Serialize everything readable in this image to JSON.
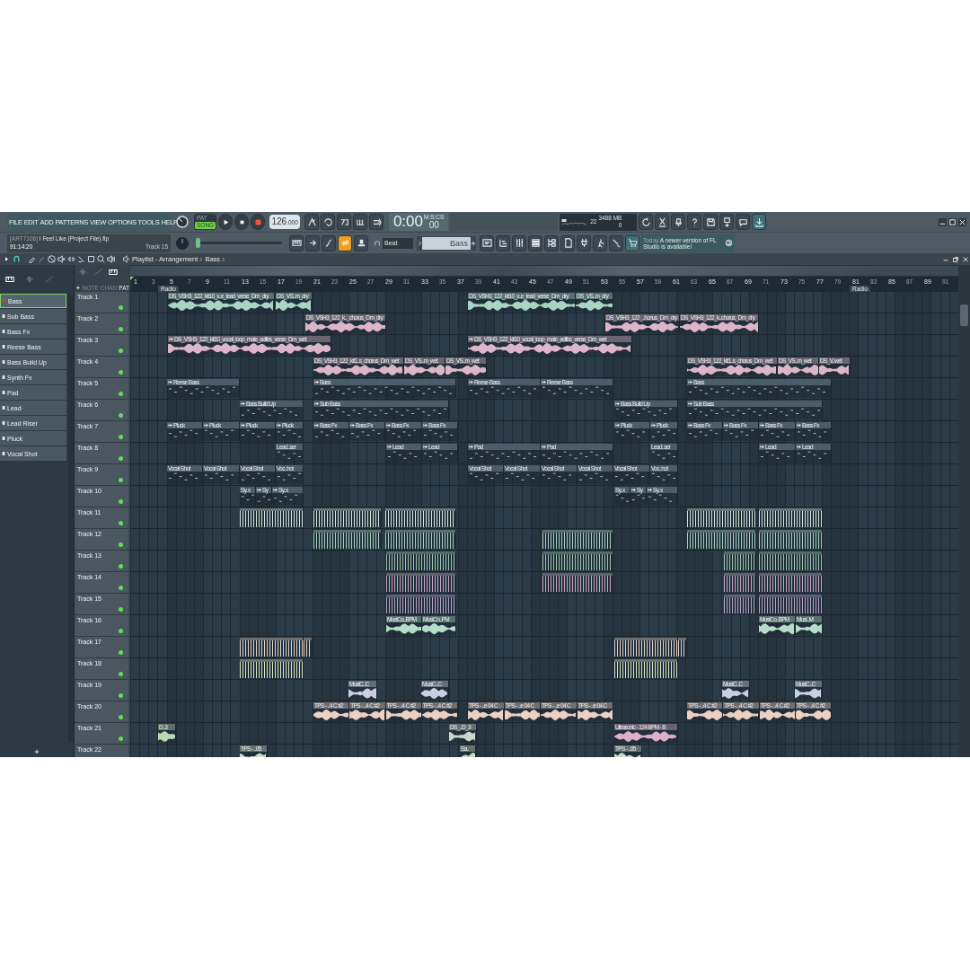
{
  "menu": [
    "FILE",
    "EDIT",
    "ADD",
    "PATTERNS",
    "VIEW",
    "OPTIONS",
    "TOOLS",
    "HELP"
  ],
  "mode": [
    {
      "label": "PAT",
      "selected": false
    },
    {
      "label": "SONG",
      "selected": true
    }
  ],
  "tempo": {
    "whole": "126",
    "fraction": ".000"
  },
  "time": {
    "main": "0:00",
    "small": "00",
    "unit": "M:S:CS"
  },
  "cpu": {
    "polyphony": "22",
    "memory": "3488 MB",
    "voices": "0"
  },
  "hint": {
    "tag": "[ART7106]",
    "file": "I Feel Like (Project File).flp",
    "position": "91:14:20",
    "track": "Track 15"
  },
  "link_button": {
    "on": true
  },
  "master_slider": {
    "level": 0
  },
  "snap": "Beat",
  "pattern": "Bass",
  "news": {
    "date": "Today",
    "text": "A newer version of FL Studio is available!"
  },
  "playlist": {
    "title": "Playlist - Arrangement",
    "pattern": "Bass"
  },
  "picker_tabs": [
    "NOTE",
    "CHAN",
    "PAT"
  ],
  "patterns": [
    {
      "name": "Bass",
      "selected": true
    },
    {
      "name": "Sub Bass",
      "selected": false
    },
    {
      "name": "Bass Fx",
      "selected": false
    },
    {
      "name": "Reese Bass",
      "selected": false
    },
    {
      "name": "Bass Build Up",
      "selected": false
    },
    {
      "name": "Synth Fx",
      "selected": false
    },
    {
      "name": "Pad",
      "selected": false
    },
    {
      "name": "Lead",
      "selected": false
    },
    {
      "name": "Lead Riser",
      "selected": false
    },
    {
      "name": "Pluck",
      "selected": false
    },
    {
      "name": "Vocal Shot",
      "selected": false
    }
  ],
  "ruler": [
    "1",
    "3",
    "5",
    "7",
    "9",
    "11",
    "13",
    "15",
    "17",
    "19",
    "21",
    "23",
    "25",
    "27",
    "29",
    "31",
    "33",
    "35",
    "37",
    "39",
    "41",
    "43",
    "45",
    "47",
    "49",
    "51",
    "53",
    "55",
    "57",
    "59",
    "61",
    "63",
    "65",
    "67",
    "69",
    "71",
    "73",
    "75",
    "77",
    "79",
    "81",
    "83",
    "85",
    "87",
    "89",
    "91"
  ],
  "markers": [
    "Radio",
    "Radio"
  ],
  "tracks": [
    {
      "name": "Track 1",
      "enabled": true,
      "clips": [
        {
          "kind": "audio",
          "label": "DS_VSH3_122_kit10_v..e_lead_verse_Dm_dry",
          "color": "#a9d3c3"
        },
        {
          "kind": "audio",
          "label": "DS_VS..m_dry",
          "color": "#a9d3c3"
        },
        {
          "kind": "audio",
          "label": "DS_VSH3_122_kit10_v..e_lead_verse_Dm_dry",
          "color": "#a9d3c3"
        },
        {
          "kind": "audio",
          "label": "DS_VS..m_dry",
          "color": "#a9d3c3"
        }
      ]
    },
    {
      "name": "Track 2",
      "enabled": true,
      "clips": [
        {
          "kind": "audio",
          "label": "DS_VSH3_122_k.._chorus_Dm_dry",
          "color": "#dcb6c8"
        },
        {
          "kind": "audio",
          "label": "DS_VSH3_122_..honus_Dm_dry",
          "color": "#dcb6c8"
        },
        {
          "kind": "audio",
          "label": "DS_VSH3_122_k..chorus_Dm_dry",
          "color": "#dcb6c8"
        }
      ]
    },
    {
      "name": "Track 3",
      "enabled": true,
      "clips": [
        {
          "kind": "audio",
          "label": "DS_VSH3_122_kit10_vocal_loop_male_adlibs_verse_Dm_wet",
          "color": "#dcb6c8"
        },
        {
          "kind": "audio",
          "label": "DS_VSH3_122_kit10_vocal_loop_male_adlibs_verse_Dm_wet",
          "color": "#dcb6c8"
        }
      ]
    },
    {
      "name": "Track 4",
      "enabled": true,
      "clips": [
        {
          "kind": "audio",
          "label": "DS_VSH3_122_kit1..s_chorus_Dm_wet",
          "color": "#dcb6c8"
        },
        {
          "kind": "audio",
          "label": "DS_VS..m_wet",
          "color": "#dcb6c8"
        },
        {
          "kind": "audio",
          "label": "DS_VS..m_wet",
          "color": "#dcb6c8"
        },
        {
          "kind": "audio",
          "label": "DS_VSH3_122_kit1..s_chorus_Dm_wet",
          "color": "#dcb6c8"
        },
        {
          "kind": "audio",
          "label": "DS_VS..m_wet",
          "color": "#dcb6c8"
        },
        {
          "kind": "audio",
          "label": "DS_V..wet",
          "color": "#dcb6c8"
        }
      ]
    },
    {
      "name": "Track 5",
      "enabled": true,
      "clips": [
        {
          "kind": "pattern",
          "label": "Reese Bass"
        },
        {
          "kind": "pattern",
          "label": "Bass"
        },
        {
          "kind": "pattern",
          "label": "Reese Bass"
        },
        {
          "kind": "pattern",
          "label": "Reese Bass"
        },
        {
          "kind": "pattern",
          "label": "Bass"
        }
      ]
    },
    {
      "name": "Track 6",
      "enabled": true,
      "clips": [
        {
          "kind": "pattern",
          "label": "Bass Build Up"
        },
        {
          "kind": "pattern",
          "label": "Sub Bass"
        },
        {
          "kind": "pattern",
          "label": "Bass Build Up"
        },
        {
          "kind": "pattern",
          "label": "Sub Bass"
        }
      ]
    },
    {
      "name": "Track 7",
      "enabled": true,
      "clips": [
        {
          "kind": "pattern",
          "label": "Pluck"
        },
        {
          "kind": "pattern",
          "label": "Pluck"
        },
        {
          "kind": "pattern",
          "label": "Pluck"
        },
        {
          "kind": "pattern",
          "label": "Pluck"
        },
        {
          "kind": "pattern",
          "label": "Bass Fx"
        },
        {
          "kind": "pattern",
          "label": "Bass Fx"
        },
        {
          "kind": "pattern",
          "label": "Bass Fx"
        },
        {
          "kind": "pattern",
          "label": "Bass Fx"
        },
        {
          "kind": "pattern",
          "label": "Pluck"
        },
        {
          "kind": "pattern",
          "label": "Pluck"
        },
        {
          "kind": "pattern",
          "label": "Bass Fx"
        },
        {
          "kind": "pattern",
          "label": "Bass Fx"
        },
        {
          "kind": "pattern",
          "label": "Bass Fx"
        },
        {
          "kind": "pattern",
          "label": "Bass Fx"
        }
      ]
    },
    {
      "name": "Track 8",
      "enabled": true,
      "clips": [
        {
          "kind": "pattern",
          "label": "Lead..ser"
        },
        {
          "kind": "pattern",
          "label": "Lead"
        },
        {
          "kind": "pattern",
          "label": "Lead"
        },
        {
          "kind": "pattern",
          "label": "Pad"
        },
        {
          "kind": "pattern",
          "label": "Pad"
        },
        {
          "kind": "pattern",
          "label": "Lead..ser"
        },
        {
          "kind": "pattern",
          "label": "Lead"
        },
        {
          "kind": "pattern",
          "label": "Lead"
        }
      ]
    },
    {
      "name": "Track 9",
      "enabled": true,
      "clips": [
        {
          "kind": "pattern",
          "label": "Vocal Shot"
        },
        {
          "kind": "pattern",
          "label": "Vocal Shot"
        },
        {
          "kind": "pattern",
          "label": "Vocal Shot"
        },
        {
          "kind": "pattern",
          "label": "Voc..hot"
        },
        {
          "kind": "pattern",
          "label": "Vocal Shot"
        },
        {
          "kind": "pattern",
          "label": "Vocal Shot"
        },
        {
          "kind": "pattern",
          "label": "Vocal Shot"
        },
        {
          "kind": "pattern",
          "label": "Vocal Shot"
        },
        {
          "kind": "pattern",
          "label": "Vocal Shot"
        },
        {
          "kind": "pattern",
          "label": "Voc..hot"
        }
      ]
    },
    {
      "name": "Track 10",
      "enabled": true,
      "clips": [
        {
          "kind": "pattern",
          "label": "Sy..x"
        },
        {
          "kind": "pattern",
          "label": "Sy"
        },
        {
          "kind": "pattern",
          "label": "Sy..x"
        },
        {
          "kind": "pattern",
          "label": "Sy..x"
        },
        {
          "kind": "pattern",
          "label": "Sy"
        },
        {
          "kind": "pattern",
          "label": "Sy..x"
        }
      ]
    },
    {
      "name": "Track 11",
      "enabled": true,
      "clips": [
        {
          "kind": "beat",
          "color": "#d5e6df"
        },
        {
          "kind": "beat",
          "color": "#d5e6df"
        },
        {
          "kind": "beat",
          "color": "#d5e6df"
        },
        {
          "kind": "beat",
          "color": "#d5e6df"
        },
        {
          "kind": "beat",
          "color": "#d5e6df"
        }
      ]
    },
    {
      "name": "Track 12",
      "enabled": true,
      "clips": [
        {
          "kind": "beat",
          "color": "#a6d4c2"
        },
        {
          "kind": "beat",
          "color": "#a6d4c2"
        },
        {
          "kind": "beat",
          "color": "#a6d4c2"
        },
        {
          "kind": "beat",
          "color": "#a6d4c2"
        },
        {
          "kind": "beat",
          "color": "#a6d4c2"
        }
      ]
    },
    {
      "name": "Track 13",
      "enabled": true,
      "clips": [
        {
          "kind": "beat",
          "color": "#9cc4a8"
        },
        {
          "kind": "beat",
          "color": "#9cc4a8"
        },
        {
          "kind": "beat",
          "color": "#9cc4a8"
        },
        {
          "kind": "beat",
          "color": "#9cc4a8"
        }
      ]
    },
    {
      "name": "Track 14",
      "enabled": true,
      "clips": [
        {
          "kind": "beat",
          "color": "#c9a9c9"
        },
        {
          "kind": "beat",
          "color": "#c9a9c9"
        },
        {
          "kind": "beat",
          "color": "#c9a9c9"
        },
        {
          "kind": "beat",
          "color": "#c9a9c9"
        }
      ]
    },
    {
      "name": "Track 15",
      "enabled": true,
      "clips": [
        {
          "kind": "beat",
          "color": "#b9a3cc"
        },
        {
          "kind": "beat",
          "color": "#b9a3cc"
        },
        {
          "kind": "beat",
          "color": "#b9a3cc"
        }
      ]
    },
    {
      "name": "Track 16",
      "enabled": true,
      "clips": [
        {
          "kind": "audio",
          "label": "MusiCo..BPM",
          "color": "#b5dcc6"
        },
        {
          "kind": "audio",
          "label": "MusiCo..PM",
          "color": "#b5dcc6"
        },
        {
          "kind": "audio",
          "label": "MusiCo..BPM",
          "color": "#b5dcc6"
        },
        {
          "kind": "audio",
          "label": "Musi..M",
          "color": "#b5dcc6"
        }
      ]
    },
    {
      "name": "Track 17",
      "enabled": true,
      "clips": [
        {
          "kind": "beat",
          "color": "#e3d6cb"
        },
        {
          "kind": "beat",
          "color": "#e3d6cb"
        },
        {
          "kind": "beat",
          "color": "#e3d6cb"
        },
        {
          "kind": "beat",
          "color": "#e3d6cb"
        }
      ]
    },
    {
      "name": "Track 18",
      "enabled": true,
      "clips": [
        {
          "kind": "beat",
          "color": "#d9e8c2"
        },
        {
          "kind": "beat",
          "color": "#d9e8c2"
        }
      ]
    },
    {
      "name": "Track 19",
      "enabled": true,
      "clips": [
        {
          "kind": "audio",
          "label": "MusiC..C",
          "color": "#c8cfe0"
        },
        {
          "kind": "audio",
          "label": "MusiC..C",
          "color": "#c8cfe0"
        },
        {
          "kind": "audio",
          "label": "MusiC..C",
          "color": "#c8cfe0"
        },
        {
          "kind": "audio",
          "label": "MusiC..C",
          "color": "#c8cfe0"
        }
      ]
    },
    {
      "name": "Track 20",
      "enabled": true,
      "clips": [
        {
          "kind": "audio",
          "label": "TPS - ..4 C #2",
          "color": "#ecd0c2"
        },
        {
          "kind": "audio",
          "label": "TPS - ..4 C #2",
          "color": "#ecd0c2"
        },
        {
          "kind": "audio",
          "label": "TPS - ..4 C #2",
          "color": "#ecd0c2"
        },
        {
          "kind": "audio",
          "label": "TPS - ..4 C #2",
          "color": "#ecd0c2"
        },
        {
          "kind": "audio",
          "label": "TPS - ..e 04 C",
          "color": "#ecd0c2"
        },
        {
          "kind": "audio",
          "label": "TPS - ..e 04 C",
          "color": "#ecd0c2"
        },
        {
          "kind": "audio",
          "label": "TPS - ..e 04 C",
          "color": "#ecd0c2"
        },
        {
          "kind": "audio",
          "label": "TPS - ..e 04 C",
          "color": "#ecd0c2"
        },
        {
          "kind": "audio",
          "label": "TPS - ..4 C #2",
          "color": "#ecd0c2"
        },
        {
          "kind": "audio",
          "label": "TPS - ..4 C #2",
          "color": "#ecd0c2"
        },
        {
          "kind": "audio",
          "label": "TPS - ..4 C #2",
          "color": "#ecd0c2"
        },
        {
          "kind": "audio",
          "label": "TPS - ..4 C #2",
          "color": "#ecd0c2"
        }
      ]
    },
    {
      "name": "Track 21",
      "enabled": true,
      "clips": [
        {
          "kind": "audio",
          "label": "D..3",
          "color": "#b8d9b0"
        },
        {
          "kind": "audio",
          "label": "DS_..D_3",
          "color": "#c9d8c9"
        },
        {
          "kind": "audio",
          "label": "Ultrasonic - 124 BPM - B",
          "color": "#dcb0c8"
        }
      ]
    },
    {
      "name": "Track 22",
      "clips": [
        {
          "kind": "audio",
          "label": "TPS - ..05",
          "color": "#c9dcc0"
        },
        {
          "kind": "audio",
          "label": "Sa..",
          "color": "#c9dcc0"
        },
        {
          "kind": "audio",
          "label": "TPS - ..05",
          "color": "#c9dcc0"
        }
      ]
    }
  ]
}
